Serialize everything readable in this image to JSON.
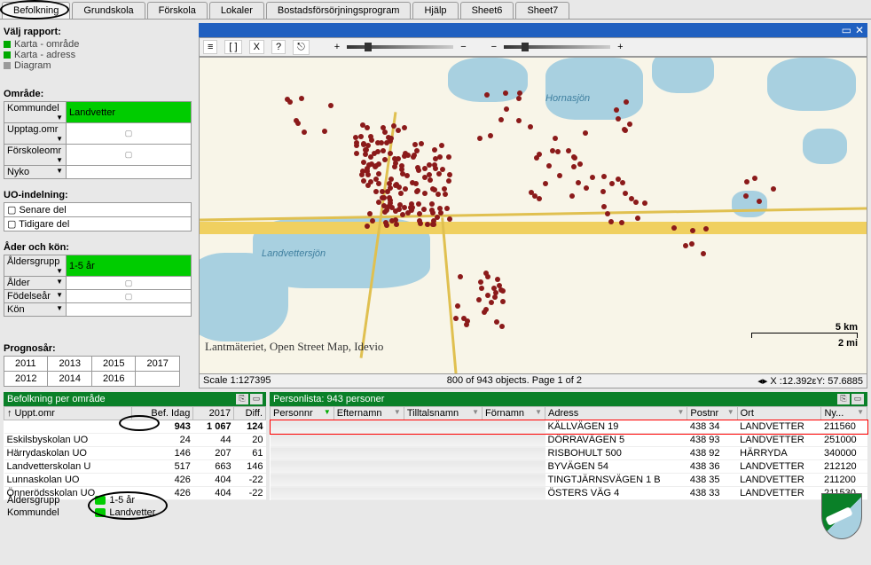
{
  "tabs": [
    "Befolkning",
    "Grundskola",
    "Förskola",
    "Lokaler",
    "Bostadsförsörjningsprogram",
    "Hjälp",
    "Sheet6",
    "Sheet7"
  ],
  "sidebar": {
    "report_label": "Välj rapport:",
    "reports": [
      "Karta - område",
      "Karta - adress",
      "Diagram"
    ],
    "omrade_label": "Område:",
    "omrade_rows": [
      {
        "label": "Kommundel",
        "value": "Landvetter",
        "selected": true
      },
      {
        "label": "Upptag.omr",
        "value": ""
      },
      {
        "label": "Förskoleomr",
        "value": ""
      },
      {
        "label": "Nyko",
        "value": ""
      }
    ],
    "uo_label": "UO-indelning:",
    "uo_items": [
      "Senare del",
      "Tidigare del"
    ],
    "alder_label": "Åder och kön:",
    "alder_rows": [
      {
        "label": "Åldersgrupp",
        "value": "1-5 år",
        "selected": true
      },
      {
        "label": "Ålder",
        "value": ""
      },
      {
        "label": "Födelseår",
        "value": ""
      },
      {
        "label": "Kön",
        "value": ""
      }
    ],
    "prognos_label": "Prognosår:",
    "years": [
      [
        "2011",
        "2013",
        "2015",
        "2017"
      ],
      [
        "2012",
        "2014",
        "2016",
        ""
      ]
    ]
  },
  "map": {
    "toolbar_btns": [
      "≡",
      "[ ]",
      "X",
      "?",
      "⎋"
    ],
    "labels": {
      "hornasjon": "Hornasjön",
      "landvettersjon": "Landvettersjön"
    },
    "scale_km": "5 km",
    "scale_mi": "2 mi",
    "attribution": "Lantmäteriet, Open Street Map, Idevio",
    "status_left": "Scale 1:127395",
    "status_mid": "800 of 943 objects. Page 1 of 2",
    "status_right": "◂▸ X :12.392εY: 57.6885"
  },
  "bef_table": {
    "title": "Befolkning per område",
    "headers": [
      "↑ Uppt.omr",
      "Bef. Idag",
      "2017",
      "Diff."
    ],
    "rows": [
      {
        "c0": "",
        "c1": "943",
        "c2": "1 067",
        "c3": "124"
      },
      {
        "c0": "Eskilsbyskolan UO",
        "c1": "24",
        "c2": "44",
        "c3": "20"
      },
      {
        "c0": "Härrydaskolan UO",
        "c1": "146",
        "c2": "207",
        "c3": "61"
      },
      {
        "c0": "Landvetterskolan U",
        "c1": "517",
        "c2": "663",
        "c3": "146"
      },
      {
        "c0": "Lunnaskolan UO",
        "c1": "426",
        "c2": "404",
        "c3": "-22"
      },
      {
        "c0": "Önnerödsskolan UO",
        "c1": "426",
        "c2": "404",
        "c3": "-22"
      }
    ]
  },
  "person_table": {
    "title": "Personlista: 943 personer",
    "headers": [
      "Personnr",
      "Efternamn",
      "Tilltalsnamn",
      "Förnamn",
      "Adress",
      "Postnr",
      "Ort",
      "Ny..."
    ],
    "rows": [
      {
        "adress": "KÄLLVÄGEN 19",
        "postnr": "438 34",
        "ort": "LANDVETTER",
        "ny": "211560"
      },
      {
        "adress": "DÖRRAVÄGEN 5",
        "postnr": "438 93",
        "ort": "LANDVETTER",
        "ny": "251000"
      },
      {
        "adress": "RISBOHULT 500",
        "postnr": "438 92",
        "ort": "HÄRRYDA",
        "ny": "340000"
      },
      {
        "adress": "BYVÄGEN 54",
        "postnr": "438 36",
        "ort": "LANDVETTER",
        "ny": "212120"
      },
      {
        "adress": "TINGTJÄRNSVÄGEN 1 B",
        "postnr": "438 35",
        "ort": "LANDVETTER",
        "ny": "211200"
      },
      {
        "adress": "ÖSTERS VÄG 4",
        "postnr": "438 33",
        "ort": "LANDVETTER",
        "ny": "211530"
      }
    ]
  },
  "footer": {
    "labels": [
      "Åldersgrupp",
      "Kommundel"
    ],
    "values": [
      "1-5 år",
      "Landvetter"
    ]
  }
}
